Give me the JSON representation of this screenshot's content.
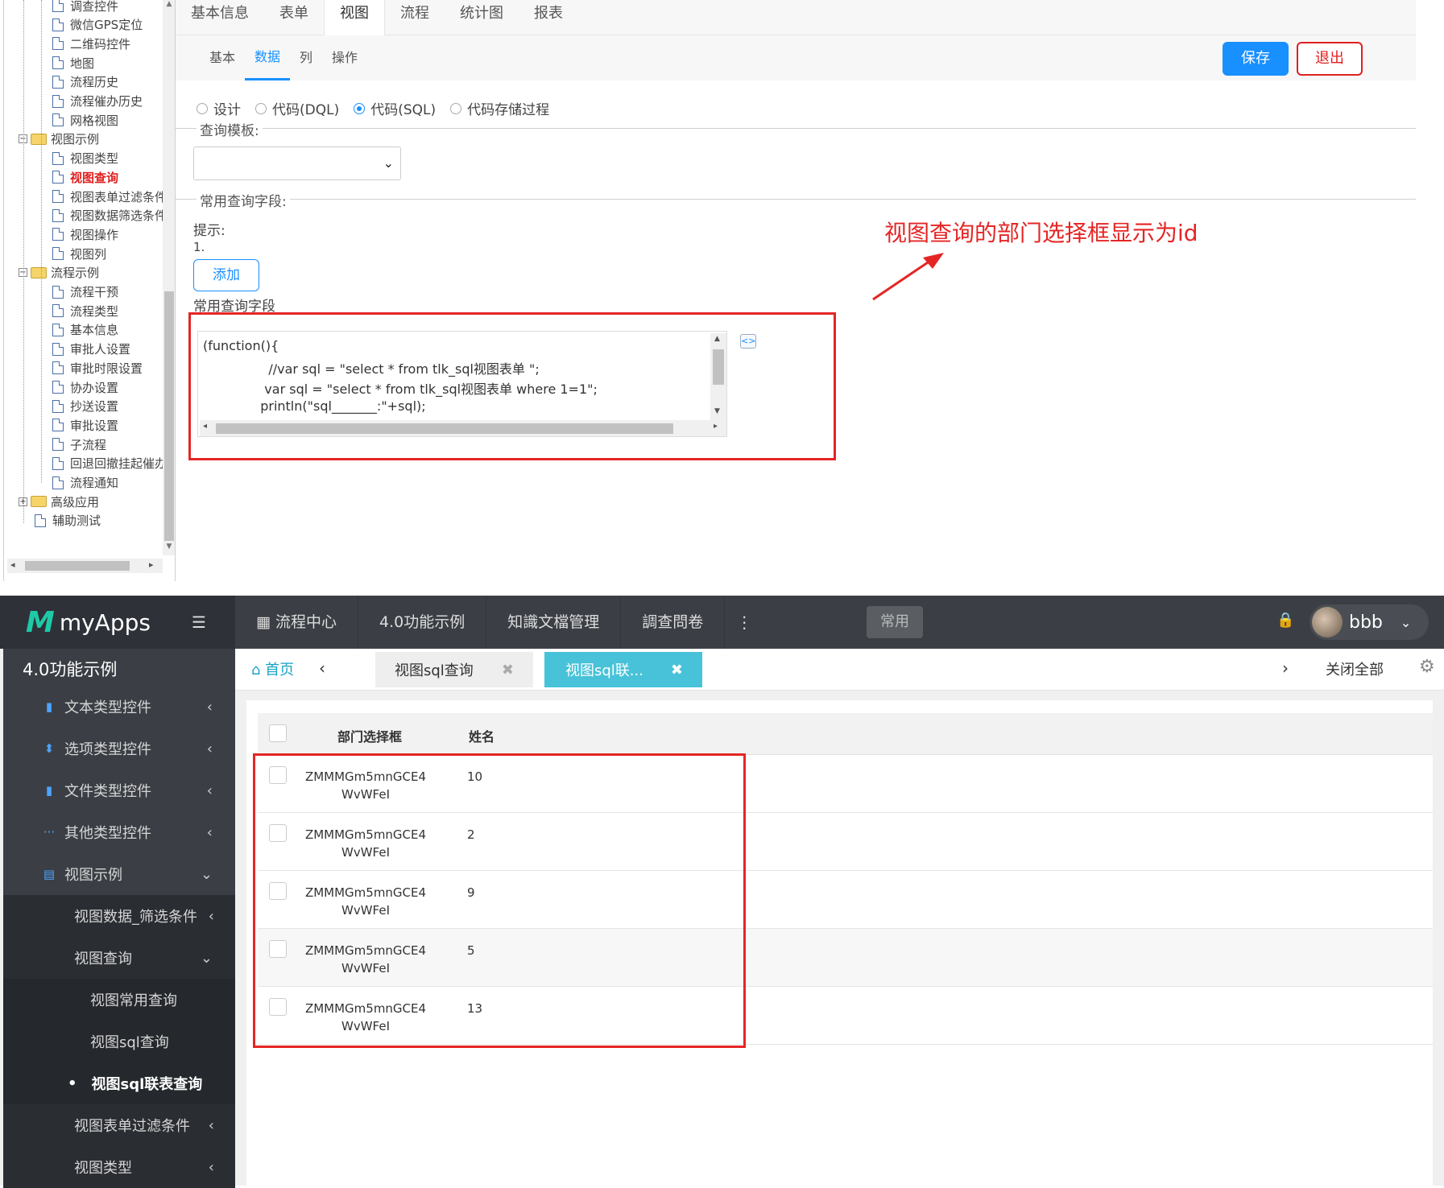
{
  "designer": {
    "tree": {
      "items": [
        {
          "label": "调查控件",
          "kind": "page"
        },
        {
          "label": "微信GPS定位",
          "kind": "page"
        },
        {
          "label": "二维码控件",
          "kind": "page"
        },
        {
          "label": "地图",
          "kind": "page"
        },
        {
          "label": "流程历史",
          "kind": "page"
        },
        {
          "label": "流程催办历史",
          "kind": "page"
        },
        {
          "label": "网格视图",
          "kind": "page"
        },
        {
          "label": "视图示例",
          "kind": "folder"
        },
        {
          "label": "视图类型",
          "kind": "page"
        },
        {
          "label": "视图查询",
          "kind": "page",
          "active": true
        },
        {
          "label": "视图表单过滤条件",
          "kind": "page"
        },
        {
          "label": "视图数据筛选条件",
          "kind": "page"
        },
        {
          "label": "视图操作",
          "kind": "page"
        },
        {
          "label": "视图列",
          "kind": "page"
        },
        {
          "label": "流程示例",
          "kind": "folder"
        },
        {
          "label": "流程干预",
          "kind": "page"
        },
        {
          "label": "流程类型",
          "kind": "page"
        },
        {
          "label": "基本信息",
          "kind": "page"
        },
        {
          "label": "审批人设置",
          "kind": "page"
        },
        {
          "label": "审批时限设置",
          "kind": "page"
        },
        {
          "label": "协办设置",
          "kind": "page"
        },
        {
          "label": "抄送设置",
          "kind": "page"
        },
        {
          "label": "审批设置",
          "kind": "page"
        },
        {
          "label": "子流程",
          "kind": "page"
        },
        {
          "label": "回退回撤挂起催办",
          "kind": "page"
        },
        {
          "label": "流程通知",
          "kind": "page"
        },
        {
          "label": "高级应用",
          "kind": "folder-closed"
        },
        {
          "label": "辅助测试",
          "kind": "page"
        }
      ],
      "toggle_open": "−",
      "toggle_closed": "+"
    },
    "main_tabs": [
      "基本信息",
      "表单",
      "视图",
      "流程",
      "统计图",
      "报表"
    ],
    "selected_main_tab": "视图",
    "sub_tabs": [
      "基本",
      "数据",
      "列",
      "操作"
    ],
    "selected_sub_tab": "数据",
    "save_label": "保存",
    "exit_label": "退出",
    "modes": [
      {
        "label": "设计",
        "checked": false
      },
      {
        "label": "代码(DQL)",
        "checked": false
      },
      {
        "label": "代码(SQL)",
        "checked": true
      },
      {
        "label": "代码存储过程",
        "checked": false
      }
    ],
    "template_legend": "查询模板:",
    "fields_legend": "常用查询字段:",
    "hint_label": "提示:",
    "hint_number": "1.",
    "add_label": "添加",
    "field_label": "常用查询字段",
    "code_lines": [
      "(function(){",
      "                //var sql = \"select * from tlk_sql视图表单 \";",
      "               var sql = \"select * from tlk_sql视图表单 where 1=1\";",
      "              println(\"sql_______:\"+sql);"
    ],
    "annotation": "视图查询的部门选择框显示为id",
    "annotation_color": "#e52525"
  },
  "app": {
    "brand": "myApps",
    "brand_color": "#1ec9a8",
    "top_nav": [
      "流程中心",
      "4.0功能示例",
      "知識文檔管理",
      "調查問卷"
    ],
    "common_label": "常用",
    "username": "bbb",
    "side_title": "4.0功能示例",
    "side_items": [
      {
        "label": "文本类型控件",
        "icon": "file-icon",
        "arrow": "<"
      },
      {
        "label": "选项类型控件",
        "icon": "sort-icon",
        "arrow": "<"
      },
      {
        "label": "文件类型控件",
        "icon": "file-icon",
        "arrow": "<"
      },
      {
        "label": "其他类型控件",
        "icon": "ellipsis-icon",
        "arrow": "<"
      },
      {
        "label": "视图示例",
        "icon": "list-icon",
        "arrow": "v"
      }
    ],
    "side_sub_items": [
      {
        "label": "视图数据_筛选条件",
        "arrow": "<"
      },
      {
        "label": "视图查询",
        "arrow": "v"
      }
    ],
    "side_sub2_items": [
      {
        "label": "视图常用查询",
        "active": false
      },
      {
        "label": "视图sql查询",
        "active": false
      },
      {
        "label": "视图sql联表查询",
        "active": true
      }
    ],
    "side_tail_items": [
      {
        "label": "视图表单过滤条件",
        "arrow": "<"
      },
      {
        "label": "视图类型",
        "arrow": "<"
      }
    ],
    "tabs": {
      "home": "首页",
      "tab1": "视图sql查询",
      "tab2": "视图sql联...",
      "close_all": "关闭全部"
    },
    "tab_active_color": "#47c2d8",
    "grid": {
      "headers": [
        "部门选择框",
        "姓名"
      ],
      "rows": [
        {
          "dept_line1": "ZMMMGm5mnGCE4",
          "dept_line2": "WvWFeI",
          "name": "10"
        },
        {
          "dept_line1": "ZMMMGm5mnGCE4",
          "dept_line2": "WvWFeI",
          "name": "2"
        },
        {
          "dept_line1": "ZMMMGm5mnGCE4",
          "dept_line2": "WvWFeI",
          "name": "9"
        },
        {
          "dept_line1": "ZMMMGm5mnGCE4",
          "dept_line2": "WvWFeI",
          "name": "5"
        },
        {
          "dept_line1": "ZMMMGm5mnGCE4",
          "dept_line2": "WvWFeI",
          "name": "13"
        }
      ]
    }
  }
}
